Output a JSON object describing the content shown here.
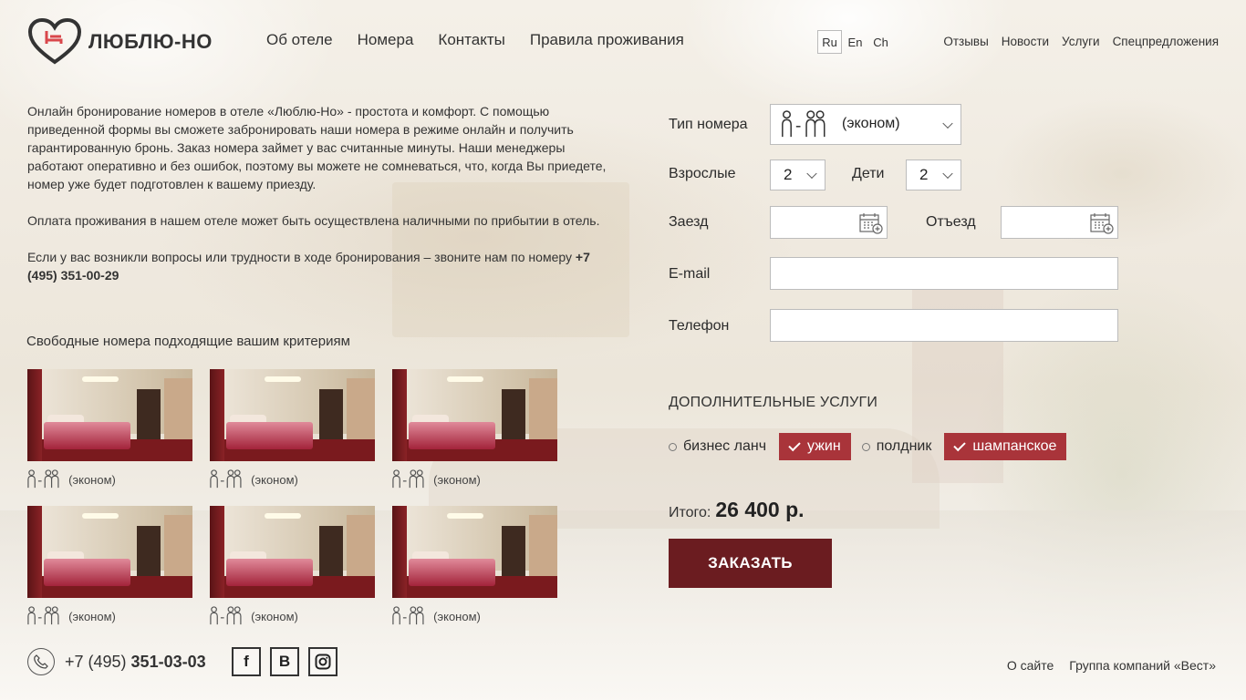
{
  "header": {
    "logo_text": "ЛЮБЛЮ-НО",
    "main_nav": [
      "Об отеле",
      "Номера",
      "Контакты",
      "Правила проживания"
    ],
    "languages": [
      "Ru",
      "En",
      "Ch"
    ],
    "active_language": "Ru",
    "top_nav": [
      "Отзывы",
      "Новости",
      "Услуги",
      "Спецпредложения"
    ]
  },
  "intro": {
    "p1": "Онлайн бронирование номеров в отеле «Люблю-Но» - простота и комфорт. С помощью приведенной формы вы сможете забронировать наши номера в режиме онлайн и получить гарантированную бронь. Заказ номера займет у вас считанные минуты. Наши менеджеры работают оперативно и без ошибок, поэтому вы можете не сомневаться, что, когда Вы приедете, номер уже будет подготовлен к вашему приезду.",
    "p2": "Оплата проживания в нашем отеле может быть осуществлена наличными по прибытии в отель.",
    "p3_text": "Если у вас возникли вопросы или трудности в ходе бронирования – звоните нам по номеру ",
    "p3_phone": "+7 (495) 351-00-29"
  },
  "rooms": {
    "title": "Свободные номера подходящие вашим критериям",
    "items": [
      {
        "caption": "(эконом)"
      },
      {
        "caption": "(эконом)"
      },
      {
        "caption": "(эконом)"
      },
      {
        "caption": "(эконом)"
      },
      {
        "caption": "(эконом)"
      },
      {
        "caption": "(эконом)"
      }
    ]
  },
  "form": {
    "room_type_label": "Тип номера",
    "room_type_value": "(эконом)",
    "adults_label": "Взрослые",
    "adults_value": "2",
    "children_label": "Дети",
    "children_value": "2",
    "checkin_label": "Заезд",
    "checkin_value": "",
    "checkout_label": "Отъезд",
    "checkout_value": "",
    "email_label": "E-mail",
    "email_value": "",
    "phone_label": "Телефон",
    "phone_value": ""
  },
  "extras": {
    "title": "ДОПОЛНИТЕЛЬНЫЕ УСЛУГИ",
    "items": [
      {
        "label": "бизнес ланч",
        "selected": false
      },
      {
        "label": "ужин",
        "selected": true
      },
      {
        "label": "полдник",
        "selected": false
      },
      {
        "label": "шампанское",
        "selected": true
      }
    ]
  },
  "total": {
    "label": "Итого:",
    "value": "26 400 р."
  },
  "order_button": "ЗАКАЗАТЬ",
  "footer": {
    "phone_prefix": "+7 (495) ",
    "phone_main": "351-03-03",
    "socials": [
      "f",
      "B",
      "instagram"
    ],
    "links": [
      "О сайте",
      "Группа компаний «Вест»"
    ]
  },
  "colors": {
    "accent": "#a9343a",
    "button": "#6b1c20",
    "logo_red": "#d9474b"
  }
}
